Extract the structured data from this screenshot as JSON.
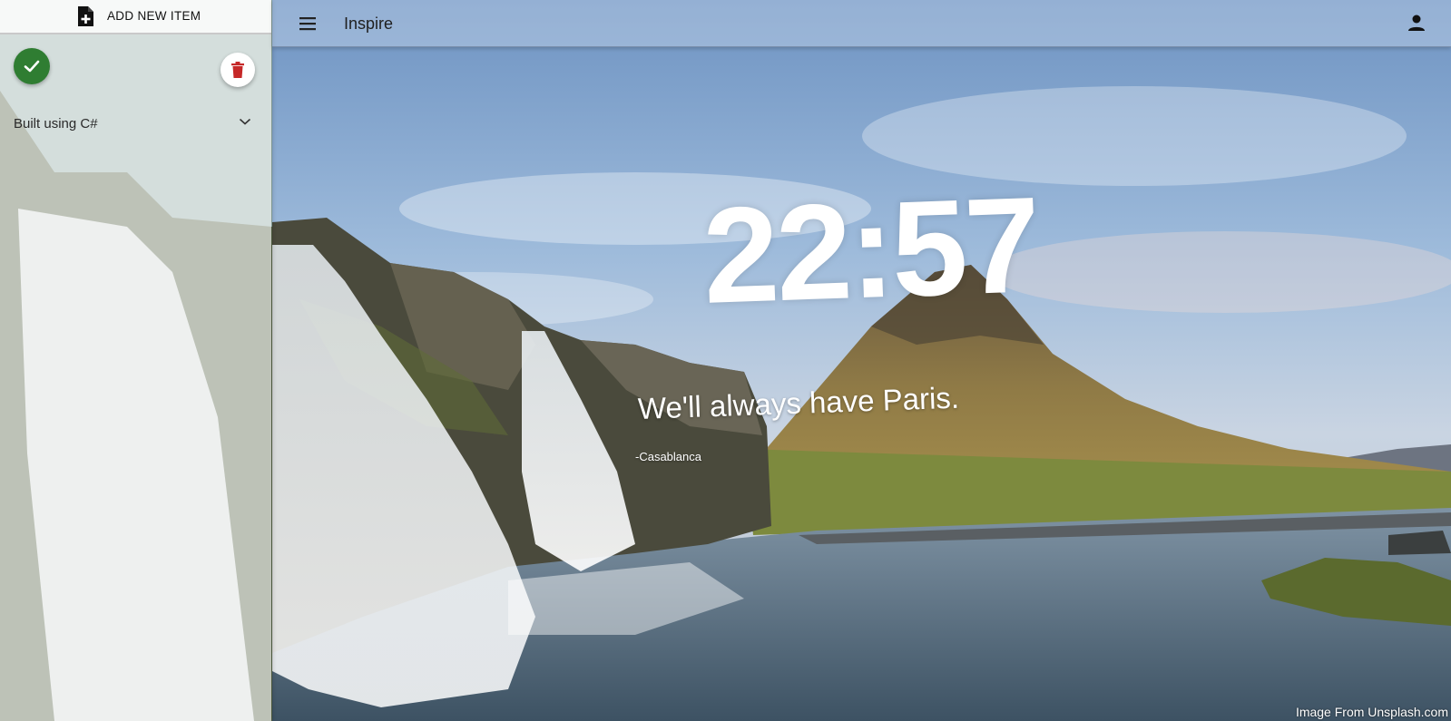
{
  "header": {
    "title": "Inspire",
    "menu_icon": "menu-icon",
    "account_icon": "account-icon"
  },
  "drawer": {
    "add_item_label": "ADD NEW ITEM",
    "add_item_icon": "note-add-icon",
    "complete_icon": "check-icon",
    "delete_icon": "trash-icon",
    "section_label": "Built using C#",
    "section_icon": "chevron-down-icon"
  },
  "main": {
    "time": "22:57",
    "quote": "We'll always have Paris.",
    "quote_author": "-Casablanca",
    "credit": "Image From Unsplash.com"
  },
  "colors": {
    "accent_green": "#2f7d32",
    "delete_red": "#c62828",
    "sky": "#7fa6cf",
    "water": "#3f5566"
  }
}
